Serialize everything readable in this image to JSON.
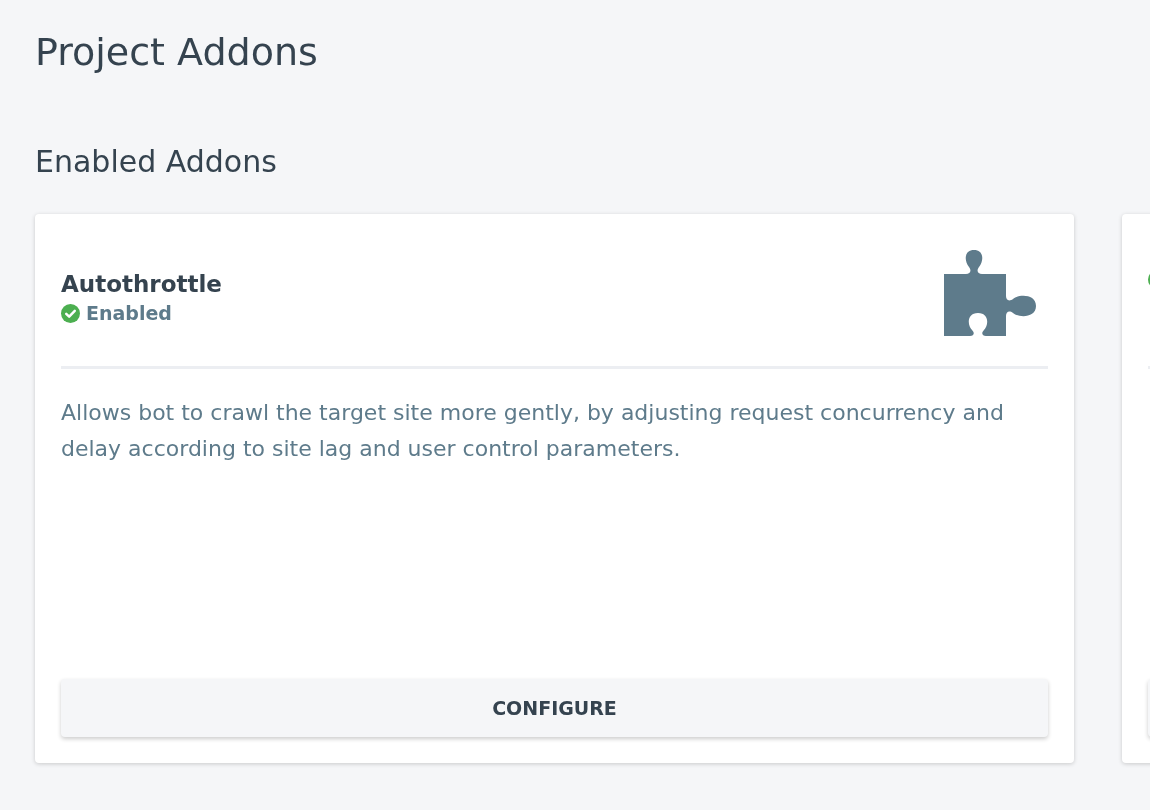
{
  "page_title": "Project Addons",
  "section_title": "Enabled Addons",
  "addons": [
    {
      "name": "Autothrottle",
      "enabled": true,
      "status": "Enabled",
      "description": "Allows bot to crawl the target site more gently, by adjusting request concurrency and delay according to site lag and user control parameters.",
      "button": "CONFIGURE"
    },
    {
      "enabled": true
    }
  ]
}
